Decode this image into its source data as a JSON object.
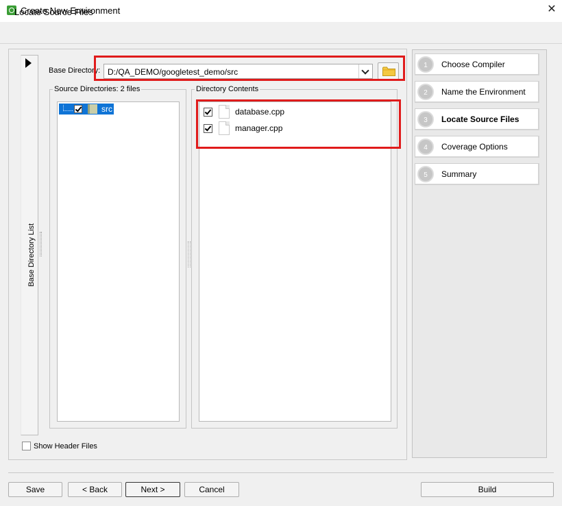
{
  "window": {
    "title": "Create New Environment",
    "icon": "app-q-icon",
    "close_icon": "close-icon"
  },
  "page": {
    "title": "Locate Source Files"
  },
  "side_panel": {
    "label": "Base Directory List",
    "expand_icon": "triangle-right-icon"
  },
  "base_directory": {
    "label": "Base Directory:",
    "value": "D:/QA_DEMO/googletest_demo/src",
    "browse_icon": "folder-icon"
  },
  "source_directories": {
    "title": "Source Directories: 2 files",
    "tree": [
      {
        "label": "src",
        "checked": true,
        "selected": true
      }
    ]
  },
  "directory_contents": {
    "title": "Directory Contents",
    "files": [
      {
        "name": "database.cpp",
        "checked": true
      },
      {
        "name": "manager.cpp",
        "checked": true
      }
    ]
  },
  "options": {
    "show_header_files": {
      "label": "Show Header Files",
      "checked": false
    }
  },
  "steps": [
    {
      "num": "1",
      "label": "Choose Compiler",
      "active": false
    },
    {
      "num": "2",
      "label": "Name the Environment",
      "active": false
    },
    {
      "num": "3",
      "label": "Locate Source Files",
      "active": true
    },
    {
      "num": "4",
      "label": "Coverage Options",
      "active": false
    },
    {
      "num": "5",
      "label": "Summary",
      "active": false
    }
  ],
  "buttons": {
    "save": "Save",
    "back": "< Back",
    "next": "Next >",
    "cancel": "Cancel",
    "build": "Build"
  },
  "colors": {
    "highlight": "#e01b1b",
    "selection": "#0f74d6",
    "background": "#f0f0f0"
  }
}
